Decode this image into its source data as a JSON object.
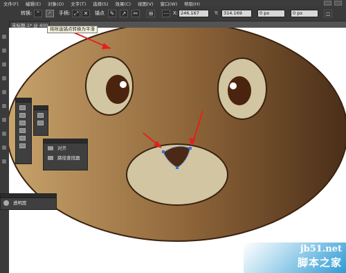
{
  "menubar": {
    "items": [
      "文件(F)",
      "编辑(E)",
      "对象(O)",
      "文字(T)",
      "选择(S)",
      "效果(C)",
      "视图(V)",
      "窗口(W)",
      "帮助(H)"
    ]
  },
  "control_bar": {
    "convert_label": "转换:",
    "handles_label": "手柄:",
    "anchors_label": "锚点",
    "x_label": "X:",
    "x_value": "246.167",
    "y_label": "Y:",
    "y_value": "314.169",
    "w_value": "0 px",
    "h_value": "0 px"
  },
  "tooltip": "将所选锚点转换为平滑",
  "document_tab": "未标题-1* @ 400",
  "panels": {
    "pathfinder": {
      "items": [
        "对齐",
        "路径查找器"
      ]
    },
    "transparency": {
      "title": "透明度"
    }
  },
  "watermark": {
    "site": "jb51.net",
    "name": "脚本之家"
  },
  "colors": {
    "accent_red": "#e4201c",
    "face_light": "#c9a46c",
    "face_dark": "#4a2e18",
    "eye_fill": "#d2c5a1",
    "pupil": "#4b2410",
    "nose": "#4a2a17",
    "watermark_blue": "#2f9bd5"
  }
}
